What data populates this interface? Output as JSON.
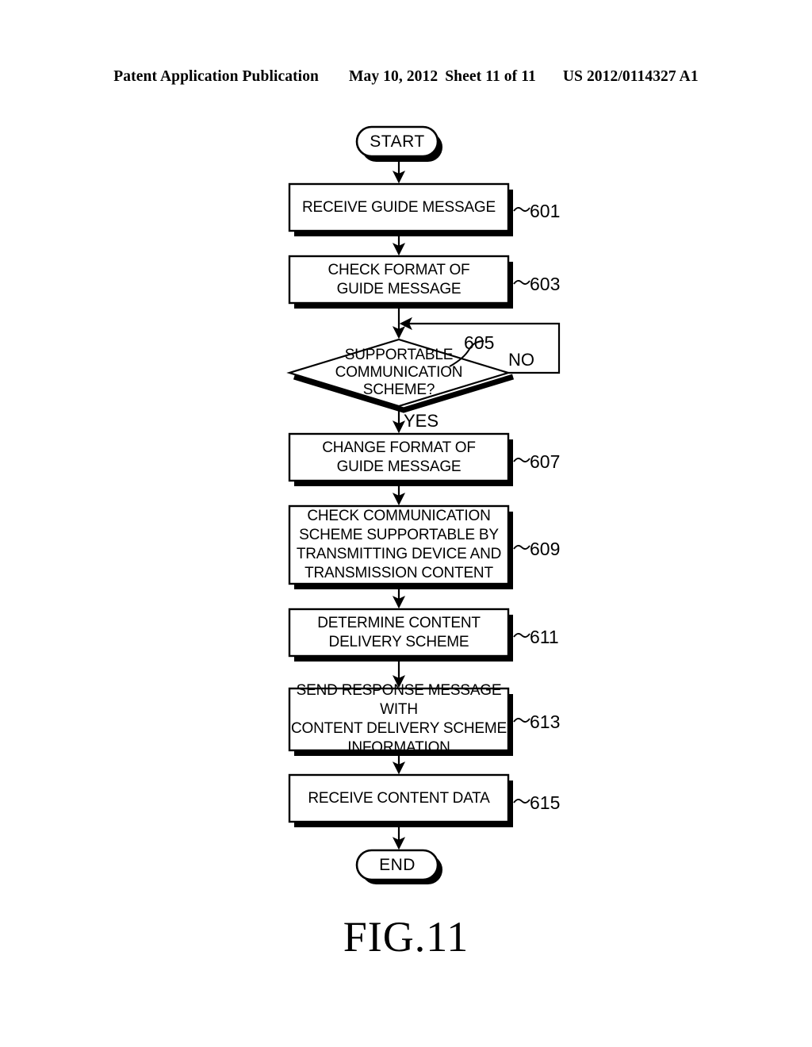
{
  "header": {
    "publication": "Patent Application Publication",
    "date": "May 10, 2012",
    "sheet": "Sheet 11 of 11",
    "patent_number": "US 2012/0114327 A1"
  },
  "figure": {
    "caption": "FIG.11"
  },
  "flowchart": {
    "start_label": "START",
    "end_label": "END",
    "yes_label": "YES",
    "no_label": "NO",
    "decision_ref": "605",
    "steps": [
      {
        "ref": "601",
        "text": "RECEIVE GUIDE MESSAGE"
      },
      {
        "ref": "603",
        "text": "CHECK FORMAT OF\nGUIDE MESSAGE"
      },
      {
        "ref": "607",
        "text": "CHANGE FORMAT OF\nGUIDE MESSAGE"
      },
      {
        "ref": "609",
        "text": "CHECK COMMUNICATION\nSCHEME SUPPORTABLE BY\nTRANSMITTING DEVICE AND\nTRANSMISSION CONTENT"
      },
      {
        "ref": "611",
        "text": "DETERMINE CONTENT\nDELIVERY SCHEME"
      },
      {
        "ref": "613",
        "text": "SEND RESPONSE MESSAGE WITH\nCONTENT DELIVERY SCHEME\nINFORMATION"
      },
      {
        "ref": "615",
        "text": "RECEIVE CONTENT DATA"
      }
    ],
    "decision": {
      "ref": "605",
      "text": "SUPPORTABLE\nCOMMUNICATION\nSCHEME?"
    },
    "colors": {
      "line": "#000000",
      "fill": "#ffffff",
      "shadow": "#000000"
    }
  }
}
